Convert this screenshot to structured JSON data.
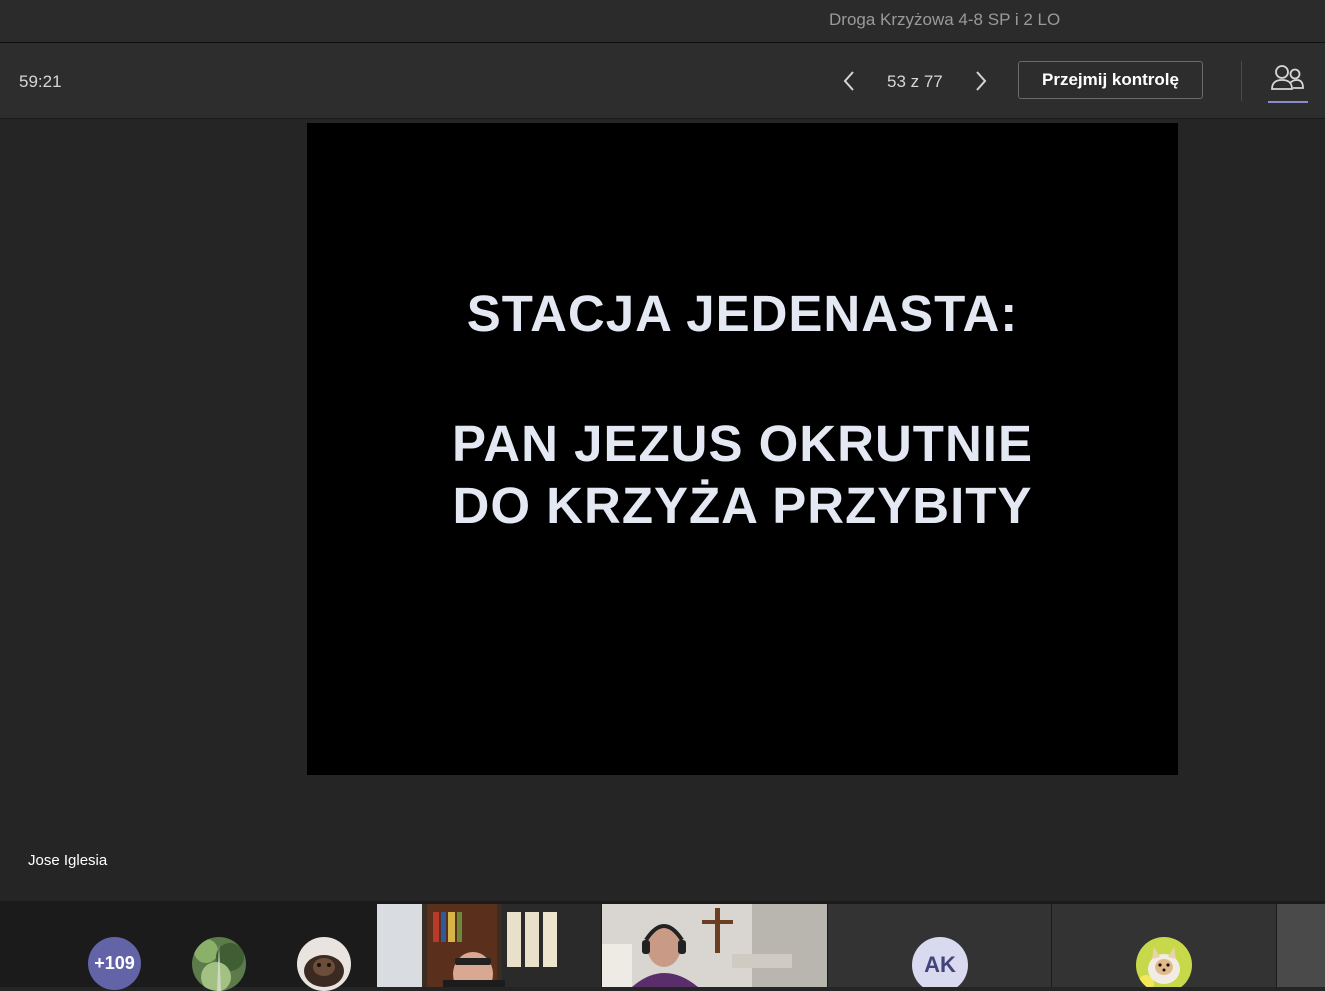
{
  "window": {
    "title": "Droga Krzyżowa 4-8 SP i 2 LO"
  },
  "toolbar": {
    "timer": "59:21",
    "prev_icon": "chevron-left-icon",
    "next_icon": "chevron-right-icon",
    "page_counter": "53 z 77",
    "take_control_label": "Przejmij kontrolę",
    "participants_icon": "people-icon"
  },
  "slide": {
    "heading": "STACJA JEDENASTA:",
    "body_line1": "PAN JEZUS OKRUTNIE",
    "body_line2": "DO KRZYŻA PRZYBITY"
  },
  "presenter": {
    "name": "Jose Iglesia"
  },
  "gallery": {
    "overflow_count": "+109",
    "initials_tile": "AK"
  },
  "colors": {
    "accent": "#6264a7",
    "slide_background": "#000000",
    "app_background": "#252525"
  }
}
